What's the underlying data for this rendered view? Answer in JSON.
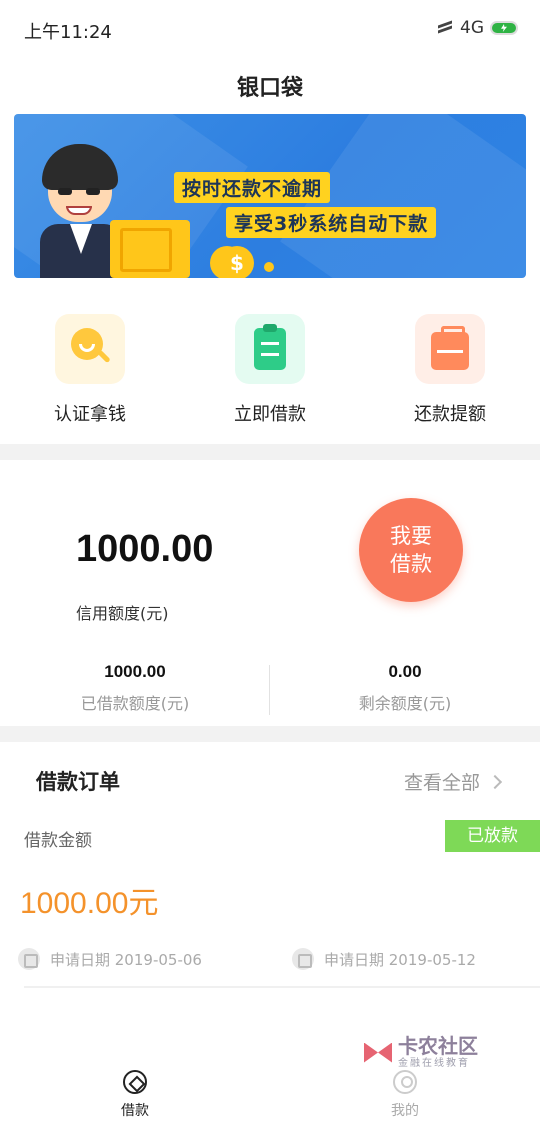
{
  "status_bar": {
    "time": "上午11:24",
    "network": "4G"
  },
  "nav": {
    "title": "银口袋"
  },
  "banner": {
    "line1": "按时还款不逾期",
    "line2": "享受3秒系统自动下款",
    "colors": {
      "background": "#2d7ee0",
      "highlight": "#ffd21f"
    }
  },
  "quick_menu": [
    {
      "label": "认证拿钱",
      "icon": "face-magnifier-icon"
    },
    {
      "label": "立即借款",
      "icon": "clipboard-icon"
    },
    {
      "label": "还款提额",
      "icon": "briefcase-icon"
    }
  ],
  "credit": {
    "amount": "1000.00",
    "label": "信用额度(元)",
    "borrow_button": {
      "line1": "我要",
      "line2": "借款"
    },
    "borrowed": {
      "value": "1000.00",
      "label": "已借款额度(元)"
    },
    "remaining": {
      "value": "0.00",
      "label": "剩余额度(元)"
    }
  },
  "orders": {
    "title": "借款订单",
    "view_all": "查看全部",
    "loan_label": "借款金额",
    "status": "已放款",
    "amount": "1000.00元",
    "apply_date_1": "申请日期  2019-05-06",
    "apply_date_2": "申请日期  2019-05-12"
  },
  "tabbar": {
    "borrow": "借款",
    "mine": "我的"
  },
  "watermark": {
    "title": "卡农社区",
    "subtitle": "金融在线教育"
  },
  "colors": {
    "accent_orange": "#f9785b",
    "amount_orange": "#f4922b",
    "status_green": "#7ed957"
  }
}
